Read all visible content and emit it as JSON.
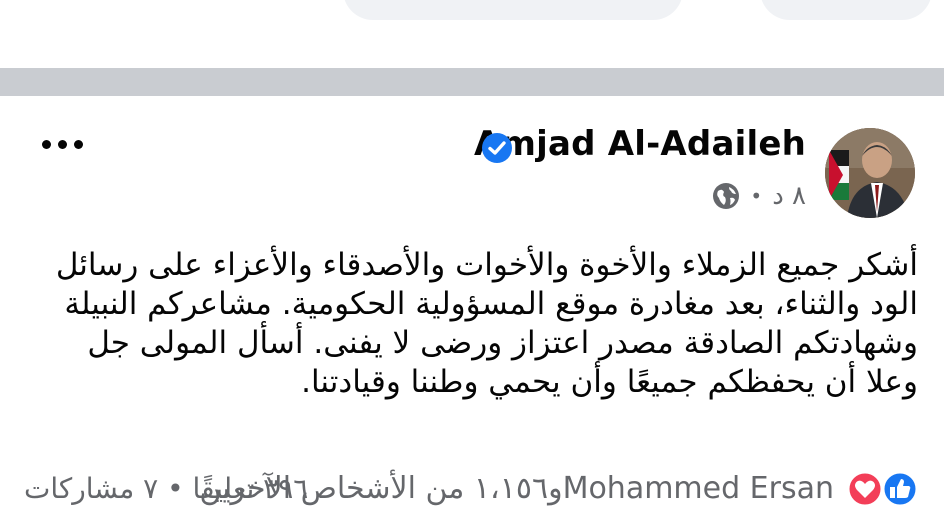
{
  "post": {
    "author": "Amjad Al-Adaileh",
    "time": "٨ د",
    "text_lines": [
      "أشكر جميع الزملاء والأخوة والأخوات والأصدقاء والأعزاء على رسائل",
      "الود والثناء، بعد مغادرة موقع المسؤولية الحكومية. مشاعركم النبيلة",
      "وشهادتكم الصادقة مصدر اعتزاز ورضى لا يفنى. أسأل المولى جل",
      "وعلا أن يحفظكم جميعًا وأن يحمي وطننا وقيادتنا."
    ],
    "reaction_name": "Mohammed Ersan",
    "reaction_rest": "و١،١٥٦ من الأشخاص الآخرين",
    "comments": "٣٩٦ تعليقًا",
    "dot": "•",
    "shares": "٧ مشاركات"
  },
  "colors": {
    "like_blue": "#1877f2",
    "love_red": "#f33e58",
    "muted_gray": "#65676b",
    "separator": "#c9ccd1"
  },
  "icons": [
    "verified-badge-icon",
    "globe-icon",
    "more-options-icon",
    "like-reaction-icon",
    "love-reaction-icon"
  ]
}
